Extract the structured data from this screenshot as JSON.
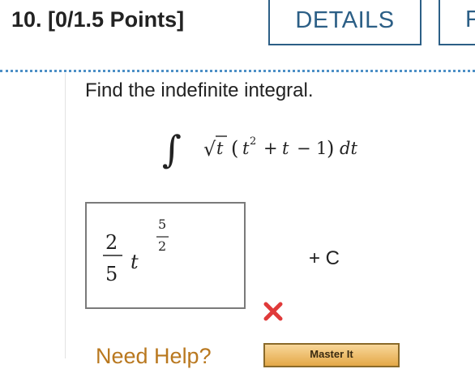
{
  "question": {
    "title": "10.  [0/1.5 Points]",
    "details_label": "DETAILS",
    "next_label": "F",
    "prompt": "Find the indefinite integral."
  },
  "integral": {
    "integral_sign": "∫",
    "sqrt_sign": "√",
    "variable": "t",
    "open_paren": "(",
    "base": "t",
    "exponent": "2",
    "plus": "+",
    "minus": "−",
    "constant": "1",
    "close_paren": ")",
    "differential": "dt"
  },
  "answer": {
    "coef_numerator": "2",
    "coef_denominator": "5",
    "variable": "t",
    "exp_numerator": "5",
    "exp_denominator": "2",
    "constant_term": "+ C",
    "status": "incorrect",
    "status_icon": "x-mark-icon",
    "status_color": "#e03a3a"
  },
  "footer": {
    "need_help_label": "Need Help?",
    "master_it_label": "Master It"
  },
  "colors": {
    "accent": "#2c5f86",
    "divider": "#4c8fc6",
    "help": "#b9781f"
  }
}
